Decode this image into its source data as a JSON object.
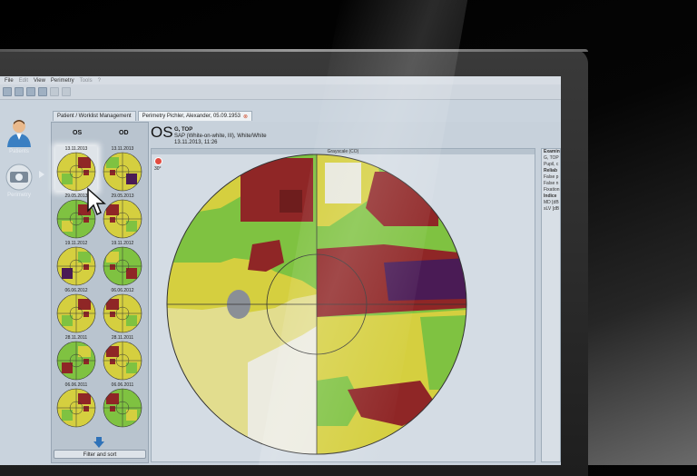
{
  "menu": [
    "File",
    "Edit",
    "View",
    "Perimetry",
    "Tools",
    "?"
  ],
  "tabs": [
    {
      "label": "Patient / Worklist Management"
    },
    {
      "label": "Perimetry Pichler, Alexander, 05.09.1953"
    }
  ],
  "sidebar": {
    "items": [
      {
        "label": "Patients",
        "icon": "patient-icon"
      },
      {
        "label": "Perimetry",
        "icon": "perimetry-device-icon"
      }
    ]
  },
  "history": {
    "os_header": "OS",
    "od_header": "OD",
    "os_dates": [
      "13.11.2013",
      "29.05.2013",
      "19.11.2012",
      "06.06.2012",
      "28.11.2011",
      "06.06.2011"
    ],
    "od_dates": [
      "13.11.2013",
      "29.05.2013",
      "19.11.2012",
      "06.06.2012",
      "28.11.2011",
      "06.06.2011"
    ],
    "filter_label": "Filter and sort"
  },
  "exam": {
    "eye": "OS",
    "program": "G, TOP",
    "test_type": "SAP (White-on-white, III), White/White",
    "datetime": "13.11.2013, 11:26",
    "angle": "30°",
    "grayscale_title": "Grayscale (CO)"
  },
  "right_panel": {
    "lines": [
      "Examin",
      "G, TOP",
      "Pupil, c",
      "Reliab",
      "False p",
      "False n",
      "Fixation",
      "Indice",
      "MD [dB",
      "sLV [dB"
    ]
  },
  "colors": {
    "normal": "#7fc241",
    "mild": "#d5cf3f",
    "moderate": "#8f2626",
    "severe": "#4a1b55",
    "light": "#e8e8dc",
    "blindspot": "#8a8f96"
  },
  "icons": {
    "record": "record-icon",
    "download_arrow": "arrow-down-icon",
    "cursor": "mouse-cursor-icon"
  }
}
